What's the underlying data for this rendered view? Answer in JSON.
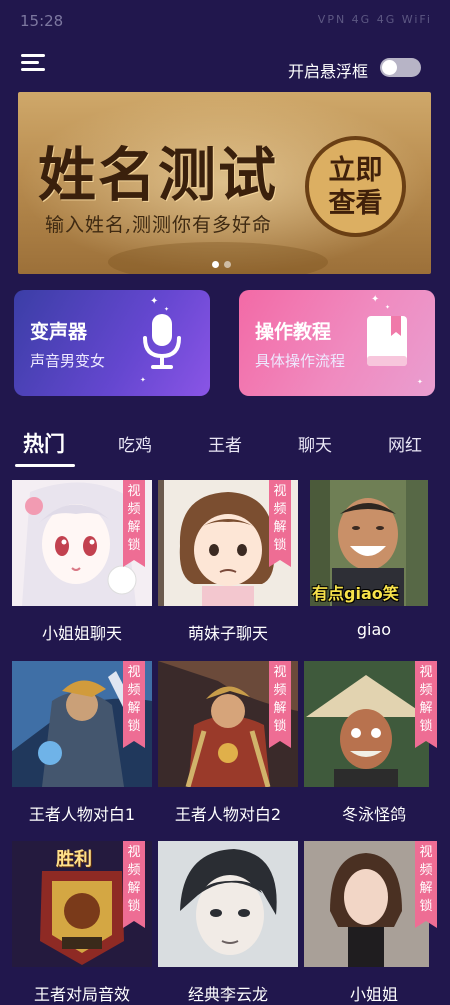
{
  "status_bar": {
    "time": "15:28",
    "indicators": "VPN 4G 4G WiFi"
  },
  "header": {
    "float_window_label": "开启悬浮框",
    "float_window_enabled": false
  },
  "banner": {
    "title": "姓名测试",
    "subtitle": "输入姓名,测测你有多好命",
    "cta_line1": "立即",
    "cta_line2": "查看",
    "slide_count": 2,
    "active_slide": 1
  },
  "features": [
    {
      "title": "变声器",
      "subtitle": "声音男变女",
      "icon": "microphone-icon"
    },
    {
      "title": "操作教程",
      "subtitle": "具体操作流程",
      "icon": "book-icon"
    }
  ],
  "tabs": [
    {
      "label": "热门",
      "active": true
    },
    {
      "label": "吃鸡",
      "active": false
    },
    {
      "label": "王者",
      "active": false
    },
    {
      "label": "聊天",
      "active": false
    },
    {
      "label": "网红",
      "active": false
    }
  ],
  "lock_badge": [
    "视",
    "频",
    "解",
    "锁"
  ],
  "cards": [
    {
      "title": "小姐姐聊天",
      "locked": true,
      "overlay": ""
    },
    {
      "title": "萌妹子聊天",
      "locked": true,
      "overlay": ""
    },
    {
      "title": "giao",
      "locked": false,
      "overlay": "有点giao笑"
    },
    {
      "title": "王者人物对白1",
      "locked": true,
      "overlay": ""
    },
    {
      "title": "王者人物对白2",
      "locked": true,
      "overlay": ""
    },
    {
      "title": "冬泳怪鸽",
      "locked": true,
      "overlay": ""
    },
    {
      "title": "王者对局音效",
      "locked": true,
      "overlay": "胜利"
    },
    {
      "title": "经典李云龙",
      "locked": false,
      "overlay": ""
    },
    {
      "title": "小姐姐",
      "locked": true,
      "overlay": ""
    }
  ],
  "colors": {
    "background": "#21174d",
    "ribbon": "#ee6d94",
    "voice_card": "#6547d0",
    "tutorial_card": "#f08abf",
    "banner_text": "#3a200c"
  }
}
